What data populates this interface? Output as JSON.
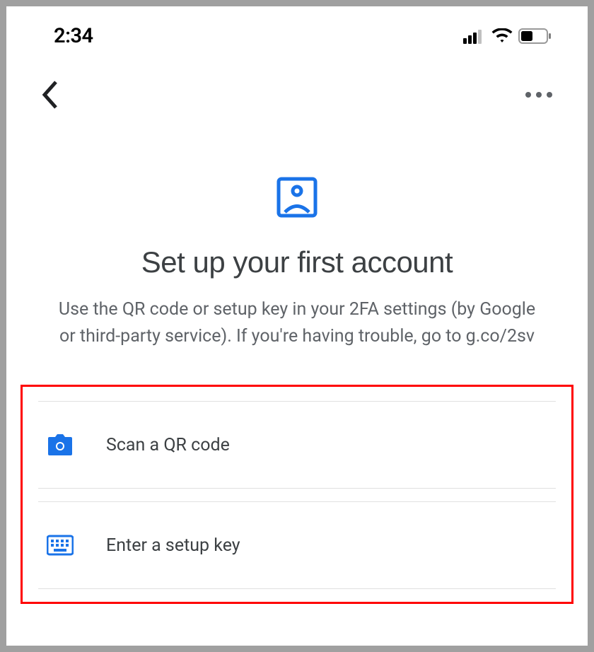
{
  "status_bar": {
    "time": "2:34"
  },
  "main": {
    "title": "Set up your first account",
    "subtitle": "Use the QR code or setup key in your 2FA settings (by Google or third-party service). If you're having trouble, go to g.co/2sv"
  },
  "options": [
    {
      "label": "Scan a QR code",
      "icon": "camera-icon"
    },
    {
      "label": "Enter a setup key",
      "icon": "keyboard-icon"
    }
  ],
  "colors": {
    "accent": "#1a73e8",
    "highlight_border": "#ff0000",
    "text_primary": "#3c4043",
    "text_secondary": "#5f6368"
  }
}
